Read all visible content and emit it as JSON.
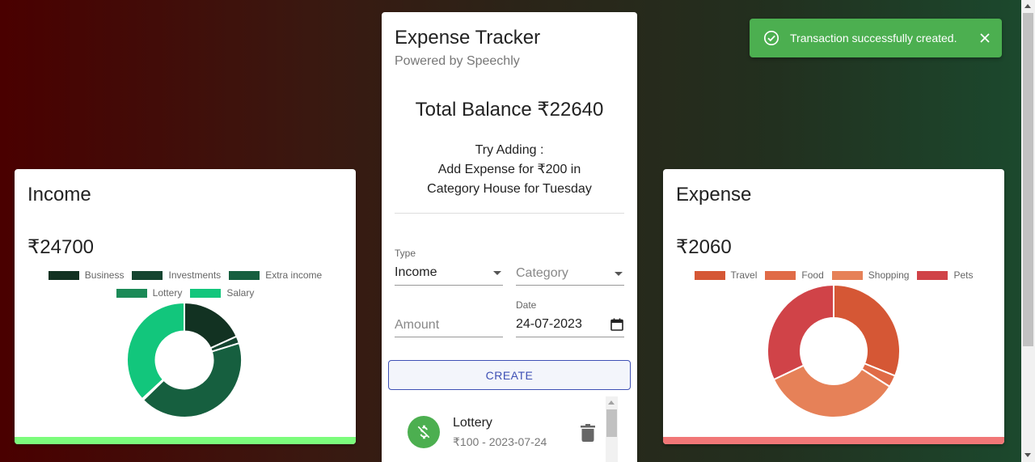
{
  "income": {
    "title": "Income",
    "amount": "₹24700",
    "bar_color": "#7cfc7c",
    "chart_data": {
      "type": "pie",
      "title": "",
      "categories": [
        "Business",
        "Investments",
        "Extra income",
        "Lottery",
        "Salary"
      ],
      "values": [
        4500,
        500,
        10500,
        100,
        9100
      ],
      "colors": [
        "#123222",
        "#154530",
        "#165f3f",
        "#1b8a57",
        "#12c67c"
      ]
    }
  },
  "expense": {
    "title": "Expense",
    "amount": "₹2060",
    "bar_color": "#f17777",
    "chart_data": {
      "type": "pie",
      "title": "",
      "categories": [
        "Travel",
        "Food",
        "Shopping",
        "Pets"
      ],
      "values": [
        640,
        60,
        700,
        660
      ],
      "colors": [
        "#d55735",
        "#e06b47",
        "#e68158",
        "#d04348"
      ]
    }
  },
  "tracker": {
    "title": "Expense Tracker",
    "subtitle": "Powered by Speechly",
    "balance": "Total Balance ₹22640",
    "hint_1": "Try Adding :",
    "hint_2": "Add Expense for ₹200 in",
    "hint_3": "Category House for Tuesday",
    "type_label": "Type",
    "type_value": "Income",
    "category_placeholder": "Category",
    "amount_placeholder": "Amount",
    "date_label": "Date",
    "date_value": "24-07-2023",
    "create_label": "CREATE",
    "transactions": [
      {
        "title": "Lottery",
        "detail": "₹100 - 2023-07-24"
      }
    ]
  },
  "toast": {
    "message": "Transaction successfully created."
  },
  "icons": {
    "toast": "check-circle-icon",
    "close": "close-icon",
    "transaction": "money-off-icon",
    "delete": "trash-icon",
    "calendar": "calendar-icon"
  }
}
